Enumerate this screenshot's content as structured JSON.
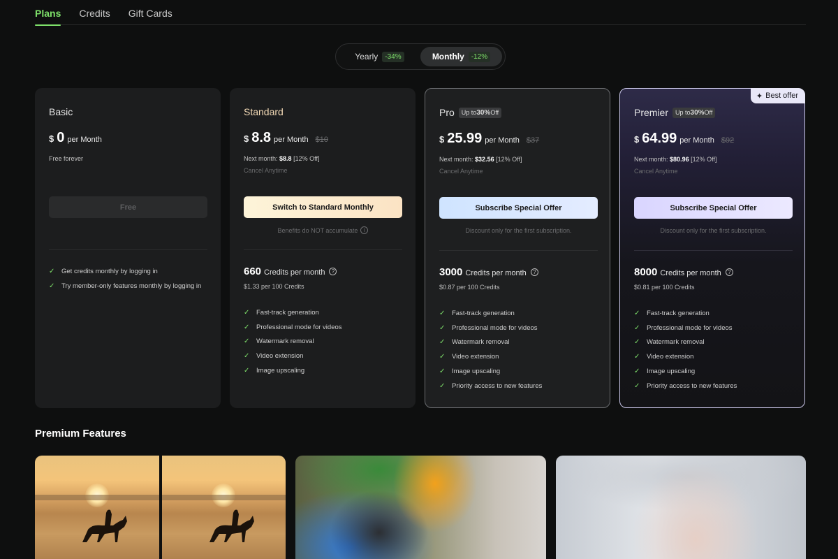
{
  "tabs": [
    {
      "label": "Plans",
      "active": true
    },
    {
      "label": "Credits",
      "active": false
    },
    {
      "label": "Gift Cards",
      "active": false
    }
  ],
  "billing_toggle": {
    "options": [
      {
        "label": "Yearly",
        "discount": "-34%",
        "active": false
      },
      {
        "label": "Monthly",
        "discount": "-12%",
        "active": true
      }
    ]
  },
  "plans": [
    {
      "name": "Basic",
      "currency": "$",
      "price": "0",
      "per": "per Month",
      "note": "Free forever",
      "button": "Free",
      "features": [
        "Get credits monthly by logging in",
        "Try member-only features monthly by logging in"
      ]
    },
    {
      "name": "Standard",
      "currency": "$",
      "price": "8.8",
      "per": "per Month",
      "old_price": "$10",
      "next_month_label": "Next month:",
      "next_month_value": "$8.8",
      "next_month_off": "[12% Off]",
      "cancel": "Cancel Anytime",
      "button": "Switch to Standard Monthly",
      "subnote": "Benefits do NOT accumulate",
      "credits": "660",
      "credits_label": "Credits per month",
      "rate": "$1.33 per 100 Credits",
      "features": [
        "Fast-track generation",
        "Professional mode for videos",
        "Watermark removal",
        "Video extension",
        "Image upscaling"
      ]
    },
    {
      "name": "Pro",
      "badge_prefix": "Up to",
      "badge_value": "30%",
      "badge_suffix": "Off",
      "currency": "$",
      "price": "25.99",
      "per": "per Month",
      "old_price": "$37",
      "next_month_label": "Next month:",
      "next_month_value": "$32.56",
      "next_month_off": "[12% Off]",
      "cancel": "Cancel Anytime",
      "button": "Subscribe Special Offer",
      "subnote": "Discount only for the first subscription.",
      "credits": "3000",
      "credits_label": "Credits per month",
      "rate": "$0.87 per 100 Credits",
      "features": [
        "Fast-track generation",
        "Professional mode for videos",
        "Watermark removal",
        "Video extension",
        "Image upscaling",
        "Priority access to new features"
      ]
    },
    {
      "name": "Premier",
      "best_offer": "Best offer",
      "badge_prefix": "Up to",
      "badge_value": "30%",
      "badge_suffix": "Off",
      "currency": "$",
      "price": "64.99",
      "per": "per Month",
      "old_price": "$92",
      "next_month_label": "Next month:",
      "next_month_value": "$80.96",
      "next_month_off": "[12% Off]",
      "cancel": "Cancel Anytime",
      "button": "Subscribe Special Offer",
      "subnote": "Discount only for the first subscription.",
      "credits": "8000",
      "credits_label": "Credits per month",
      "rate": "$0.81 per 100 Credits",
      "features": [
        "Fast-track generation",
        "Professional mode for videos",
        "Watermark removal",
        "Video extension",
        "Image upscaling",
        "Priority access to new features"
      ]
    }
  ],
  "premium_features": {
    "title": "Premium Features"
  },
  "icons": {
    "check": "check-icon",
    "info": "info-icon",
    "help": "question-circle-icon",
    "sparkle": "sparkle-icon"
  },
  "colors": {
    "accent_green": "#7ee06a",
    "background": "#0e0f0f",
    "card": "#1c1d1e"
  }
}
